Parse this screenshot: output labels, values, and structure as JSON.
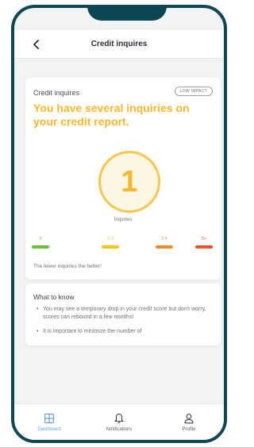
{
  "header": {
    "title": "Credit inquires"
  },
  "main_card": {
    "label": "Credit inquires",
    "badge": "LOW IMPACT",
    "headline": "You have several inquiries on your credit report.",
    "count": "1",
    "count_label": "Inquiries",
    "scale": [
      {
        "label": "0",
        "color": "#6abf3b"
      },
      {
        "label": "0-1",
        "color": "#f5c518"
      },
      {
        "label": "2-4",
        "color": "#f08a30"
      },
      {
        "label": "5+",
        "color": "#ef4f25"
      }
    ],
    "footer": "The fewer inquiries the better!"
  },
  "know_card": {
    "title": "What to know",
    "items": [
      "You may see a temporary drop in your credit score but don't worry, scores can rebound in a few months!",
      "It is important to minimize the number of"
    ]
  },
  "tabbar": {
    "tabs": [
      {
        "label": "Dashboard",
        "icon": "dashboard-icon",
        "active": true
      },
      {
        "label": "Notifications",
        "icon": "bell-icon",
        "active": false
      },
      {
        "label": "Profile",
        "icon": "user-icon",
        "active": false
      }
    ]
  },
  "colors": {
    "accent": "#f5b82e",
    "frame": "#0f4653",
    "active_tab": "#6b9fce"
  }
}
